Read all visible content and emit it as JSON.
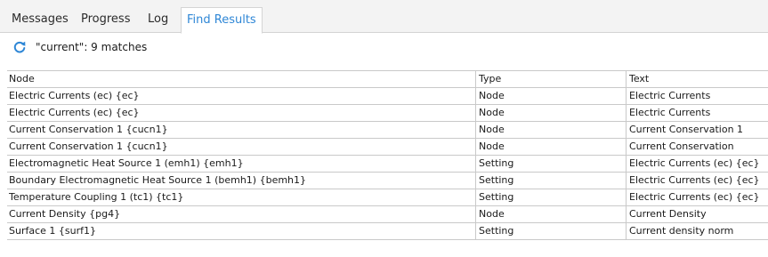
{
  "tabs": [
    {
      "label": "Messages",
      "active": false
    },
    {
      "label": "Progress",
      "active": false
    },
    {
      "label": "Log",
      "active": false
    },
    {
      "label": "Find Results",
      "active": true
    }
  ],
  "toolbar": {
    "refresh_icon": "refresh-icon",
    "summary": "\"current\": 9 matches"
  },
  "table": {
    "columns": [
      "Node",
      "Type",
      "Text"
    ],
    "rows": [
      [
        "Electric Currents (ec) {ec}",
        "Node",
        "Electric Currents"
      ],
      [
        "Electric Currents (ec) {ec}",
        "Node",
        "Electric Currents"
      ],
      [
        "Current Conservation 1 {cucn1}",
        "Node",
        "Current Conservation 1"
      ],
      [
        "Current Conservation 1 {cucn1}",
        "Node",
        "Current Conservation"
      ],
      [
        "Electromagnetic Heat Source 1 (emh1) {emh1}",
        "Setting",
        "Electric Currents (ec) {ec}"
      ],
      [
        "Boundary Electromagnetic Heat Source 1 (bemh1) {bemh1}",
        "Setting",
        "Electric Currents (ec) {ec}"
      ],
      [
        "Temperature Coupling 1 (tc1) {tc1}",
        "Setting",
        "Electric Currents (ec) {ec}"
      ],
      [
        "Current Density {pg4}",
        "Node",
        "Current Density"
      ],
      [
        "Surface 1 {surf1}",
        "Setting",
        "Current density norm"
      ]
    ]
  },
  "colors": {
    "active_tab": "#2f87d6",
    "refresh_icon": "#2f87d6"
  }
}
